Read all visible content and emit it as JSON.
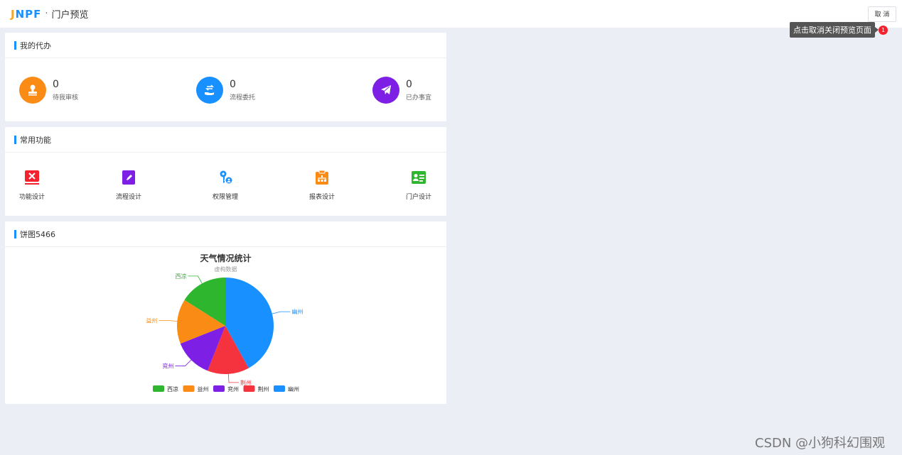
{
  "header": {
    "logo_part1": "J",
    "logo_part2": "NPF",
    "separator": "·",
    "title": "门户预览",
    "cancel_label": "取 消"
  },
  "tooltip": {
    "text": "点击取消关闭预览页面",
    "badge": "1"
  },
  "todo_card": {
    "title": "我的代办",
    "items": [
      {
        "count": "0",
        "label": "待我审核",
        "icon": "stamp-icon",
        "color": "#fa8c16"
      },
      {
        "count": "0",
        "label": "流程委托",
        "icon": "transfer-hand-icon",
        "color": "#1890ff"
      },
      {
        "count": "0",
        "label": "已办事宜",
        "icon": "paper-plane-icon",
        "color": "#7d1fe4"
      }
    ]
  },
  "func_card": {
    "title": "常用功能",
    "items": [
      {
        "label": "功能设计",
        "icon": "tools-icon",
        "color": "#f5222d"
      },
      {
        "label": "流程设计",
        "icon": "edit-icon",
        "color": "#7d1fe4"
      },
      {
        "label": "权限管理",
        "icon": "key-user-icon",
        "color": "#1890ff"
      },
      {
        "label": "报表设计",
        "icon": "clipboard-chart-icon",
        "color": "#fa8c16"
      },
      {
        "label": "门户设计",
        "icon": "contact-card-icon",
        "color": "#2fb62f"
      }
    ]
  },
  "pie_card": {
    "title": "饼图5466"
  },
  "chart_data": {
    "type": "pie",
    "title": "天气情况统计",
    "subtitle": "虚构数据",
    "legend_position": "bottom",
    "series": [
      {
        "name": "西凉",
        "value": 16,
        "color": "#2fb62f"
      },
      {
        "name": "益州",
        "value": 15,
        "color": "#fa8c16"
      },
      {
        "name": "兖州",
        "value": 13,
        "color": "#7d1fe4"
      },
      {
        "name": "荆州",
        "value": 14,
        "color": "#f5333f"
      },
      {
        "name": "幽州",
        "value": 42,
        "color": "#1890ff"
      }
    ]
  },
  "watermark": "CSDN @小狗科幻围观"
}
